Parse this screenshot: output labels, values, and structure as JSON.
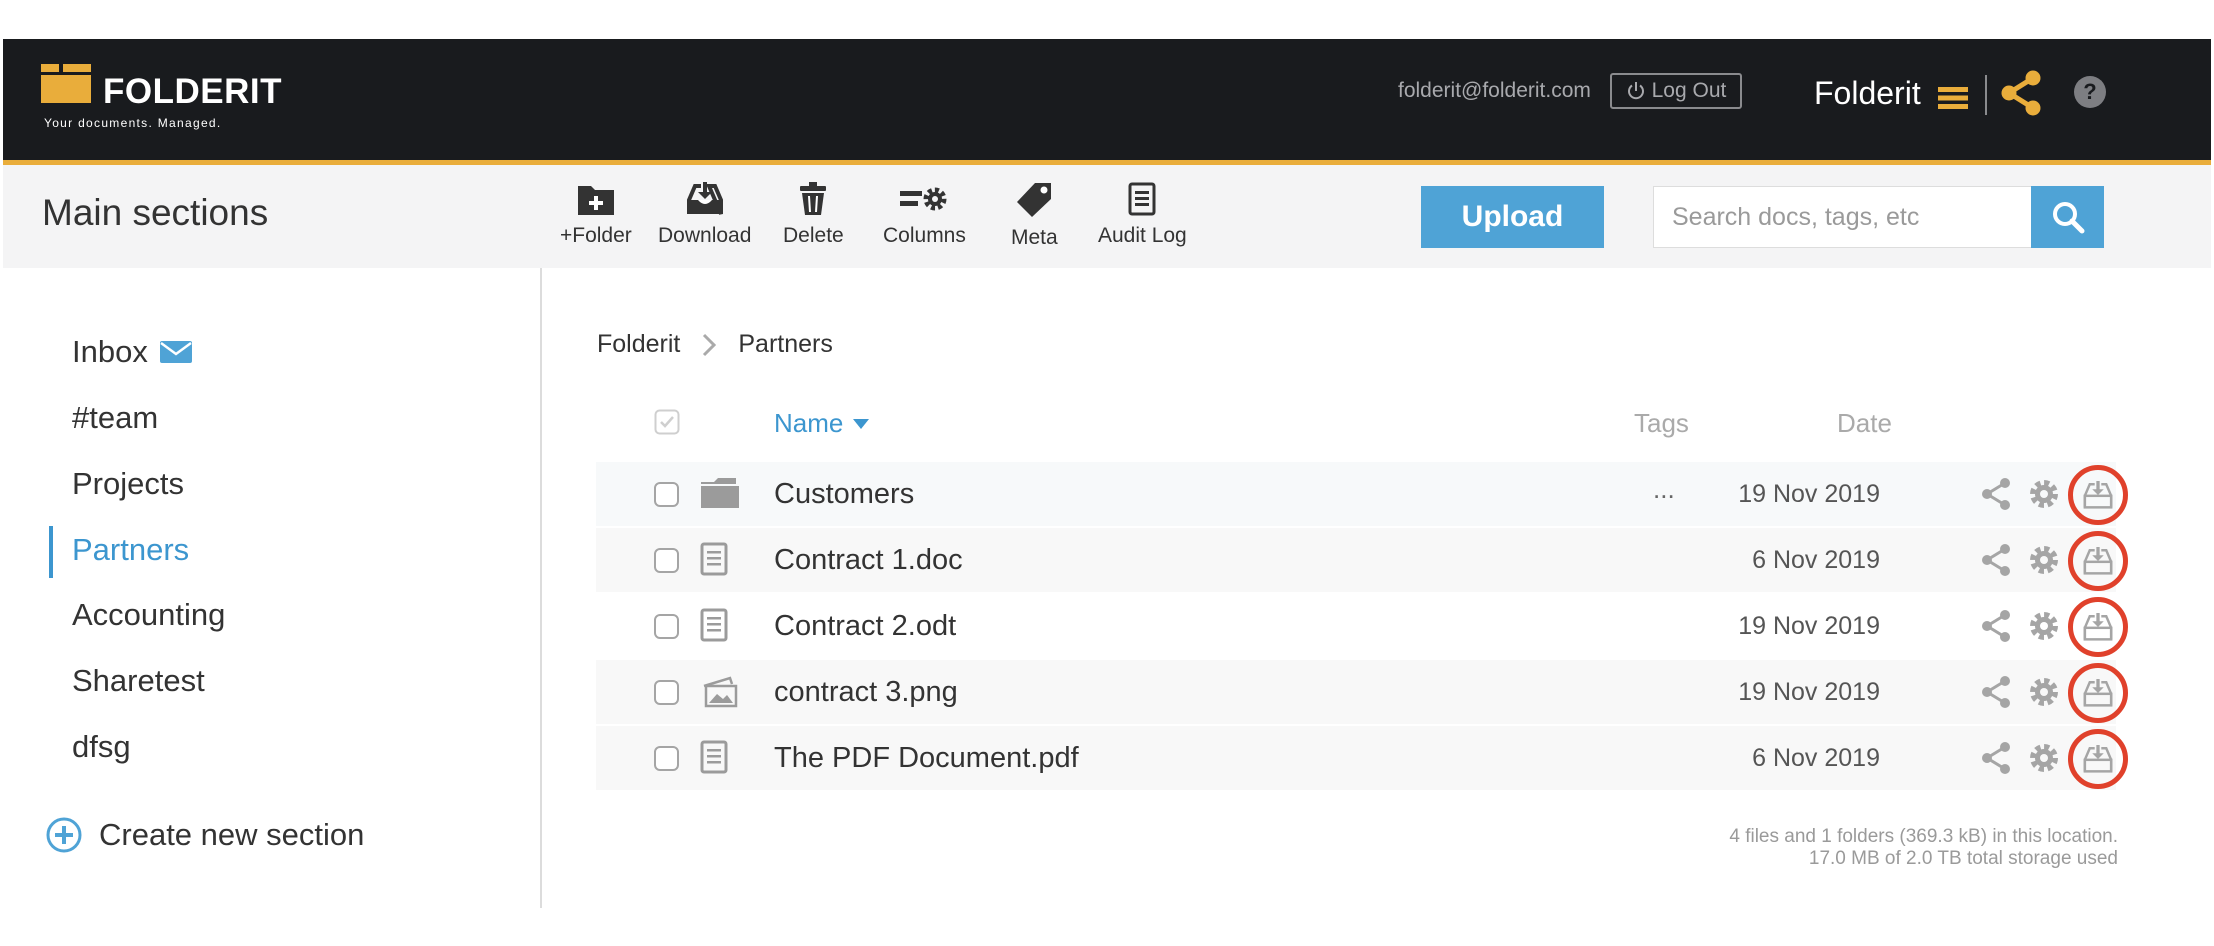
{
  "header": {
    "brand": "FOLDERIT",
    "tagline": "Your documents. Managed.",
    "email": "folderit@folderit.com",
    "logout_label": "Log Out",
    "account_name": "Folderit",
    "help_label": "?"
  },
  "toolbar": {
    "section_title": "Main sections",
    "actions": [
      {
        "label": "+Folder",
        "icon": "folder-plus-icon"
      },
      {
        "label": "Download",
        "icon": "download-tray-icon"
      },
      {
        "label": "Delete",
        "icon": "trash-icon"
      },
      {
        "label": "Columns",
        "icon": "columns-gear-icon"
      },
      {
        "label": "Meta",
        "icon": "tag-icon"
      },
      {
        "label": "Audit Log",
        "icon": "log-document-icon"
      }
    ],
    "upload_label": "Upload",
    "search_placeholder": "Search docs, tags, etc"
  },
  "sidebar": {
    "items": [
      {
        "label": "Inbox",
        "icon": "mail-icon"
      },
      {
        "label": "#team"
      },
      {
        "label": "Projects"
      },
      {
        "label": "Partners",
        "active": true
      },
      {
        "label": "Accounting"
      },
      {
        "label": "Sharetest"
      },
      {
        "label": "dfsg"
      }
    ],
    "create_label": "Create new section"
  },
  "breadcrumb": [
    "Folderit",
    "Partners"
  ],
  "table": {
    "columns": {
      "name": "Name",
      "tags": "Tags",
      "date": "Date"
    },
    "rows": [
      {
        "name": "Customers",
        "type": "folder",
        "tags": "...",
        "date": "19 Nov 2019"
      },
      {
        "name": "Contract 1.doc",
        "type": "document",
        "tags": "",
        "date": "6 Nov 2019"
      },
      {
        "name": "Contract 2.odt",
        "type": "document",
        "tags": "",
        "date": "19 Nov 2019"
      },
      {
        "name": "contract 3.png",
        "type": "image",
        "tags": "",
        "date": "19 Nov 2019"
      },
      {
        "name": "The PDF Document.pdf",
        "type": "document",
        "tags": "",
        "date": "6 Nov 2019"
      }
    ]
  },
  "footer": {
    "summary": "4 files and 1 folders (369.3 kB) in this location.",
    "storage": "17.0 MB of 2.0 TB total storage used"
  },
  "colors": {
    "accent_blue": "#4fa3d6",
    "header_bg": "#191b1e",
    "brand_yellow": "#e9ad3b",
    "highlight_red": "#e0412b"
  }
}
